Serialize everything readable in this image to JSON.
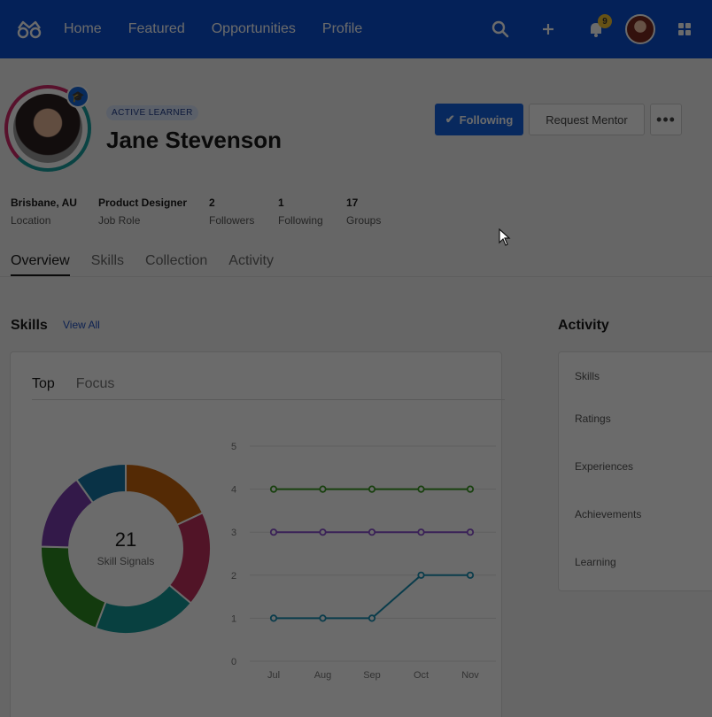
{
  "nav": {
    "links": [
      "Home",
      "Featured",
      "Opportunities",
      "Profile"
    ],
    "notification_count": "9",
    "icons": [
      "search-icon",
      "plus-icon",
      "bell-icon",
      "grid-icon"
    ]
  },
  "profile": {
    "tag": "ACTIVE LEARNER",
    "name": "Jane Stevenson",
    "following_label": "Following",
    "mentor_label": "Request Mentor",
    "more_label": "•••",
    "stats": [
      {
        "value": "Brisbane, AU",
        "label": "Location"
      },
      {
        "value": "Product Designer",
        "label": "Job Role"
      },
      {
        "value": "2",
        "label": "Followers"
      },
      {
        "value": "1",
        "label": "Following"
      },
      {
        "value": "17",
        "label": "Groups"
      }
    ],
    "tabs": [
      "Overview",
      "Skills",
      "Collection",
      "Activity"
    ]
  },
  "skills": {
    "title": "Skills",
    "view_all": "View All",
    "tabs": [
      "Top",
      "Focus"
    ],
    "signals_count": "21",
    "signals_label": "Skill Signals"
  },
  "activity": {
    "title": "Activity",
    "items": [
      "Skills",
      "Ratings",
      "Experiences",
      "Achievements",
      "Learning"
    ]
  },
  "colors": {
    "nav": "#0a4fd1",
    "accent": "#1563df",
    "donut": [
      "#c8650c",
      "#c0305e",
      "#13999a",
      "#2e8b22",
      "#7b3cae",
      "#1677a8"
    ]
  },
  "chart_data": [
    {
      "type": "pie",
      "donut": true,
      "values": [
        55,
        55,
        60,
        60,
        45,
        30
      ]
    },
    {
      "type": "line",
      "categories": [
        "Jul",
        "Aug",
        "Sep",
        "Oct",
        "Nov"
      ],
      "ylim": [
        0,
        5
      ],
      "yticks": [
        0,
        1,
        2,
        3,
        4,
        5
      ],
      "grid": true,
      "series": [
        {
          "color": "#3a9a22",
          "values": [
            4,
            4,
            4,
            4,
            4
          ]
        },
        {
          "color": "#8a4fcf",
          "values": [
            3,
            3,
            3,
            3,
            3
          ]
        },
        {
          "color": "#1a8fb3",
          "values": [
            1,
            1,
            1,
            2,
            2
          ]
        }
      ]
    }
  ]
}
